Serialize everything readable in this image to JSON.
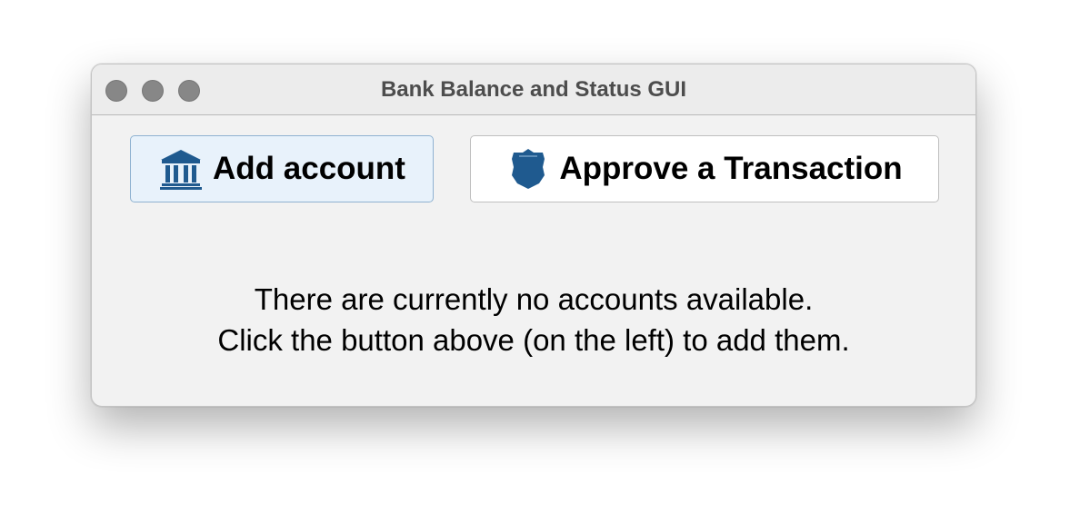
{
  "window": {
    "title": "Bank Balance and Status GUI"
  },
  "toolbar": {
    "add_account_label": "Add account",
    "add_account_icon": "bank-icon",
    "approve_label": "Approve a Transaction",
    "approve_icon": "shield-icon"
  },
  "message": {
    "line1": "There are currently no accounts available.",
    "line2": "Click the button above (on the left) to add them."
  },
  "colors": {
    "icon_blue": "#1f5a8f",
    "selected_button_bg": "#e8f2fb",
    "window_bg": "#f2f2f2"
  }
}
